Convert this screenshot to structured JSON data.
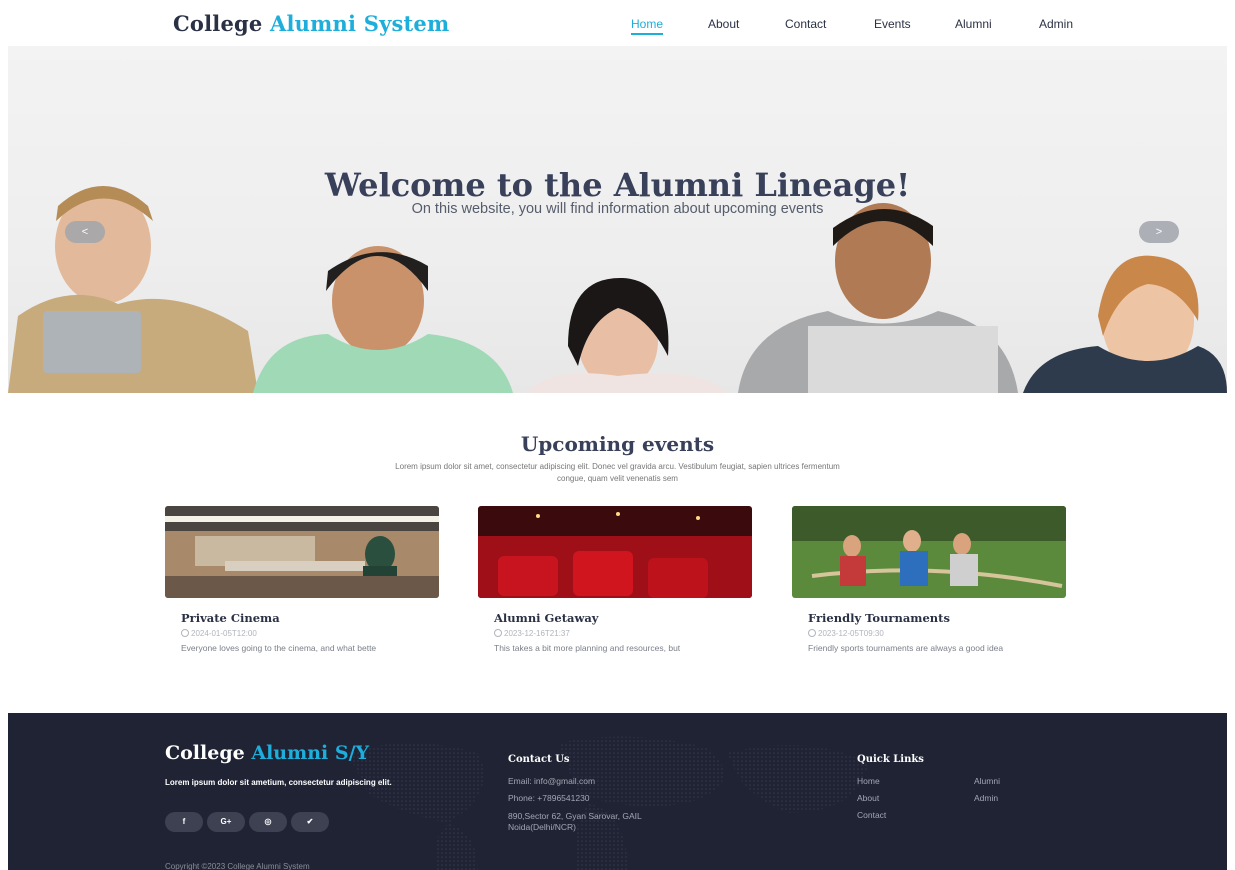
{
  "header": {
    "brand_part1": "College",
    "brand_part2": "Alumni System",
    "nav": [
      "Home",
      "About",
      "Contact",
      "Events",
      "Alumni",
      "Admin"
    ],
    "active_nav": "Home"
  },
  "hero": {
    "title": "Welcome to the Alumni Lineage!",
    "subtitle": "On this website, you will find information about upcoming events",
    "prev_label": "<",
    "next_label": ">"
  },
  "events": {
    "title": "Upcoming events",
    "description": "Lorem ipsum dolor sit amet, consectetur adipiscing elit. Donec vel gravida arcu. Vestibulum feugiat, sapien ultrices fermentum congue, quam velit venenatis sem",
    "cards": [
      {
        "title": "Private Cinema",
        "date": "2024-01-05T12:00",
        "text": "Everyone loves going to the cinema, and what bette"
      },
      {
        "title": "Alumni Getaway",
        "date": "2023-12-16T21:37",
        "text": "This takes a bit more planning and resources, but"
      },
      {
        "title": "Friendly Tournaments",
        "date": "2023-12-05T09:30",
        "text": "Friendly sports tournaments are always a good idea"
      }
    ]
  },
  "footer": {
    "brand_part1": "College",
    "brand_part2": "Alumni S/Y",
    "about": "Lorem ipsum dolor sit ametium, consectetur adipiscing elit.",
    "socials": [
      "f",
      "G+",
      "◎",
      "✔"
    ],
    "contact_heading": "Contact Us",
    "email": "Email: info@gmail.com",
    "phone": "Phone: +7896541230",
    "address": "890,Sector 62, Gyan Sarovar, GAIL Noida(Delhi/NCR)",
    "links_heading": "Quick Links",
    "links_col1": [
      "Home",
      "About",
      "Contact"
    ],
    "links_col2": [
      "Alumni",
      "Admin"
    ],
    "copyright": "Copyright ©2023 College Alumni System"
  }
}
